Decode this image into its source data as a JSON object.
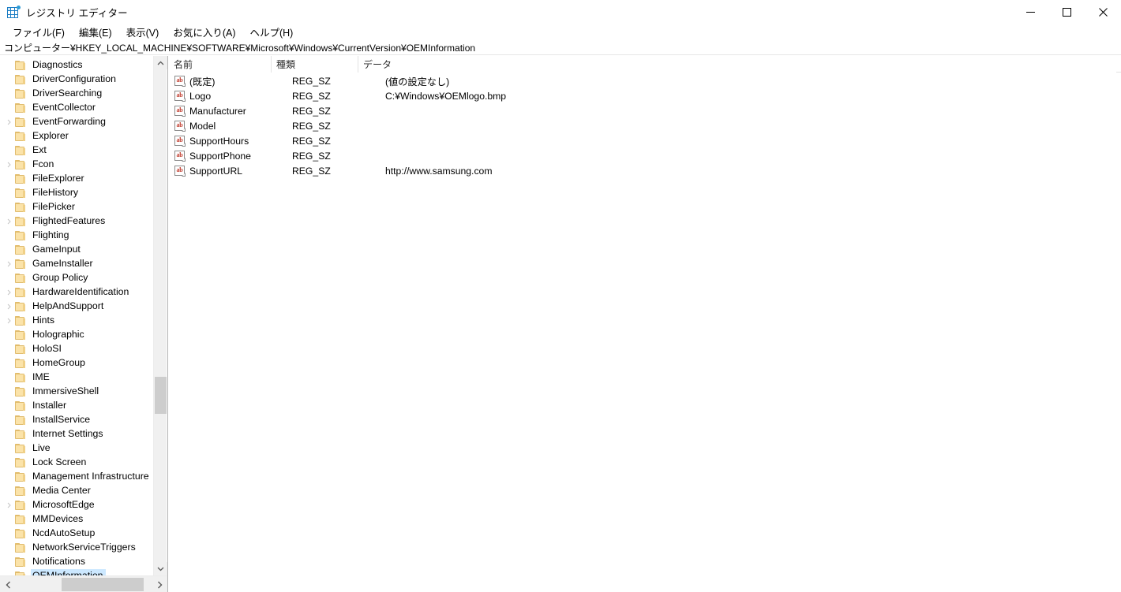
{
  "window": {
    "title": "レジストリ エディター",
    "icon": "registry-editor-icon",
    "controls": {
      "minimize": "minimize-icon",
      "maximize": "maximize-icon",
      "close": "close-icon"
    }
  },
  "menubar": {
    "items": [
      {
        "label": "ファイル(F)"
      },
      {
        "label": "編集(E)"
      },
      {
        "label": "表示(V)"
      },
      {
        "label": "お気に入り(A)"
      },
      {
        "label": "ヘルプ(H)"
      }
    ]
  },
  "address": {
    "path": "コンピューター¥HKEY_LOCAL_MACHINE¥SOFTWARE¥Microsoft¥Windows¥CurrentVersion¥OEMInformation"
  },
  "tree": {
    "items": [
      {
        "label": "Diagnostics",
        "expandable": false,
        "selected": false
      },
      {
        "label": "DriverConfiguration",
        "expandable": false,
        "selected": false
      },
      {
        "label": "DriverSearching",
        "expandable": false,
        "selected": false
      },
      {
        "label": "EventCollector",
        "expandable": false,
        "selected": false
      },
      {
        "label": "EventForwarding",
        "expandable": true,
        "selected": false
      },
      {
        "label": "Explorer",
        "expandable": false,
        "selected": false
      },
      {
        "label": "Ext",
        "expandable": false,
        "selected": false
      },
      {
        "label": "Fcon",
        "expandable": true,
        "selected": false
      },
      {
        "label": "FileExplorer",
        "expandable": false,
        "selected": false
      },
      {
        "label": "FileHistory",
        "expandable": false,
        "selected": false
      },
      {
        "label": "FilePicker",
        "expandable": false,
        "selected": false
      },
      {
        "label": "FlightedFeatures",
        "expandable": true,
        "selected": false
      },
      {
        "label": "Flighting",
        "expandable": false,
        "selected": false
      },
      {
        "label": "GameInput",
        "expandable": false,
        "selected": false
      },
      {
        "label": "GameInstaller",
        "expandable": true,
        "selected": false
      },
      {
        "label": "Group Policy",
        "expandable": false,
        "selected": false
      },
      {
        "label": "HardwareIdentification",
        "expandable": true,
        "selected": false
      },
      {
        "label": "HelpAndSupport",
        "expandable": true,
        "selected": false
      },
      {
        "label": "Hints",
        "expandable": true,
        "selected": false
      },
      {
        "label": "Holographic",
        "expandable": false,
        "selected": false
      },
      {
        "label": "HoloSI",
        "expandable": false,
        "selected": false
      },
      {
        "label": "HomeGroup",
        "expandable": false,
        "selected": false
      },
      {
        "label": "IME",
        "expandable": false,
        "selected": false
      },
      {
        "label": "ImmersiveShell",
        "expandable": false,
        "selected": false
      },
      {
        "label": "Installer",
        "expandable": false,
        "selected": false
      },
      {
        "label": "InstallService",
        "expandable": false,
        "selected": false
      },
      {
        "label": "Internet Settings",
        "expandable": false,
        "selected": false
      },
      {
        "label": "Live",
        "expandable": false,
        "selected": false
      },
      {
        "label": "Lock Screen",
        "expandable": false,
        "selected": false
      },
      {
        "label": "Management Infrastructure",
        "expandable": false,
        "selected": false
      },
      {
        "label": "Media Center",
        "expandable": false,
        "selected": false
      },
      {
        "label": "MicrosoftEdge",
        "expandable": true,
        "selected": false
      },
      {
        "label": "MMDevices",
        "expandable": false,
        "selected": false
      },
      {
        "label": "NcdAutoSetup",
        "expandable": false,
        "selected": false
      },
      {
        "label": "NetworkServiceTriggers",
        "expandable": false,
        "selected": false
      },
      {
        "label": "Notifications",
        "expandable": false,
        "selected": false
      },
      {
        "label": "OEMInformation",
        "expandable": false,
        "selected": true
      }
    ],
    "scroll": {
      "up_arrow": "chevron-up-icon",
      "down_arrow": "chevron-down-icon",
      "left_arrow": "chevron-left-icon",
      "right_arrow": "chevron-right-icon"
    }
  },
  "list": {
    "columns": [
      {
        "label": "名前"
      },
      {
        "label": "種類"
      },
      {
        "label": "データ"
      }
    ],
    "rows": [
      {
        "name": "(既定)",
        "type": "REG_SZ",
        "data": "(値の設定なし)"
      },
      {
        "name": "Logo",
        "type": "REG_SZ",
        "data": "C:¥Windows¥OEMlogo.bmp"
      },
      {
        "name": "Manufacturer",
        "type": "REG_SZ",
        "data": ""
      },
      {
        "name": "Model",
        "type": "REG_SZ",
        "data": ""
      },
      {
        "name": "SupportHours",
        "type": "REG_SZ",
        "data": ""
      },
      {
        "name": "SupportPhone",
        "type": "REG_SZ",
        "data": ""
      },
      {
        "name": "SupportURL",
        "type": "REG_SZ",
        "data": "http://www.samsung.com"
      }
    ],
    "value_icon": "string-value-icon",
    "icon_text": "ab"
  },
  "colors": {
    "selection": "#cce8ff",
    "folder": "#fbe3a9",
    "folder_border": "#e0bc6e",
    "scrollbar_thumb": "#cdcdcd",
    "scrollbar_track": "#f0f0f0",
    "icon_blue": "#1b7dc4",
    "value_icon_text": "#c0392b"
  }
}
